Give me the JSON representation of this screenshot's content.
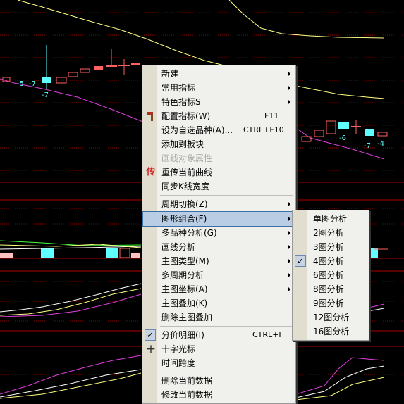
{
  "chart": {
    "background": "#000000",
    "bar_labels": [
      "-5",
      "-7",
      "-7",
      "-6",
      "-7",
      "-4"
    ]
  },
  "context_menu": {
    "items": [
      {
        "label": "新建",
        "submenu": true
      },
      {
        "label": "常用指标",
        "submenu": true
      },
      {
        "label": "特色指标S",
        "submenu": true
      },
      {
        "label": "配置指标(W)",
        "shortcut": "F11",
        "icon": "hammer-icon"
      },
      {
        "label": "设为自选品种(A)...",
        "shortcut": "CTRL+F10"
      },
      {
        "label": "添加到板块"
      },
      {
        "label": "画线对象属性",
        "disabled": true
      },
      {
        "label": "重传当前曲线",
        "icon": "chuan-icon",
        "icon_glyph": "传"
      },
      {
        "label": "同步K线宽度"
      },
      {
        "label": "周期切换(Z)",
        "submenu": true
      },
      {
        "label": "图形组合(F)",
        "submenu": true,
        "highlighted": true
      },
      {
        "label": "多品种分析(G)",
        "submenu": true
      },
      {
        "label": "画线分析",
        "submenu": true
      },
      {
        "label": "主图类型(M)",
        "submenu": true
      },
      {
        "label": "多周期分析",
        "submenu": true
      },
      {
        "label": "主图坐标(A)",
        "submenu": true
      },
      {
        "label": "主图叠加(K)"
      },
      {
        "label": "删除主图叠加"
      },
      {
        "label": "分价明细(I)",
        "shortcut": "CTRL+I",
        "checked": true
      },
      {
        "label": "十字光标",
        "icon": "crosshair-icon",
        "icon_glyph": "+"
      },
      {
        "label": "时间跨度"
      },
      {
        "label": "删除当前数据"
      },
      {
        "label": "修改当前数据"
      }
    ]
  },
  "submenu": {
    "items": [
      {
        "label": "单图分析"
      },
      {
        "label": "2图分析"
      },
      {
        "label": "3图分析"
      },
      {
        "label": "4图分析",
        "checked": true
      },
      {
        "label": "6图分析"
      },
      {
        "label": "8图分析"
      },
      {
        "label": "9图分析"
      },
      {
        "label": "12图分析"
      },
      {
        "label": "16图分析"
      }
    ]
  },
  "glyphs": {
    "check": "✓"
  }
}
